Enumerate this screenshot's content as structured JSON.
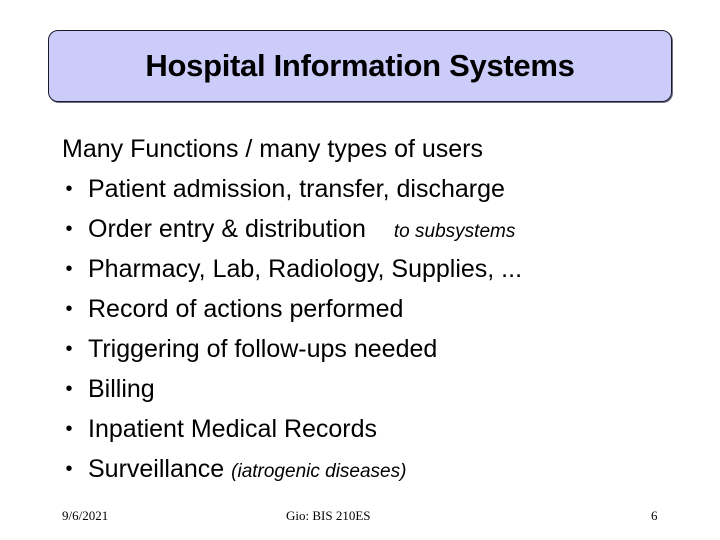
{
  "slide": {
    "title": "Hospital Information Systems",
    "intro": "Many Functions / many types of users",
    "bullets": [
      {
        "text": "Patient admission, transfer, discharge",
        "note": ""
      },
      {
        "text": "Order entry & distribution",
        "note": "to subsystems"
      },
      {
        "text": "Pharmacy, Lab, Radiology, Supplies, ...",
        "note": ""
      },
      {
        "text": "Record of actions performed",
        "note": ""
      },
      {
        "text": "Triggering of follow-ups needed",
        "note": ""
      },
      {
        "text": "Billing",
        "note": ""
      },
      {
        "text": "Inpatient Medical Records",
        "note": ""
      },
      {
        "text": "Surveillance",
        "note": "(iatrogenic diseases)"
      }
    ],
    "bullet_glyph": "•",
    "colors": {
      "title_box_fill": "#ccccfa",
      "title_box_border": "#1a1a2a",
      "text": "#000000",
      "background": "#ffffff"
    }
  },
  "footer": {
    "date": "9/6/2021",
    "center": "Gio: BIS 210ES",
    "page_number": "6"
  }
}
